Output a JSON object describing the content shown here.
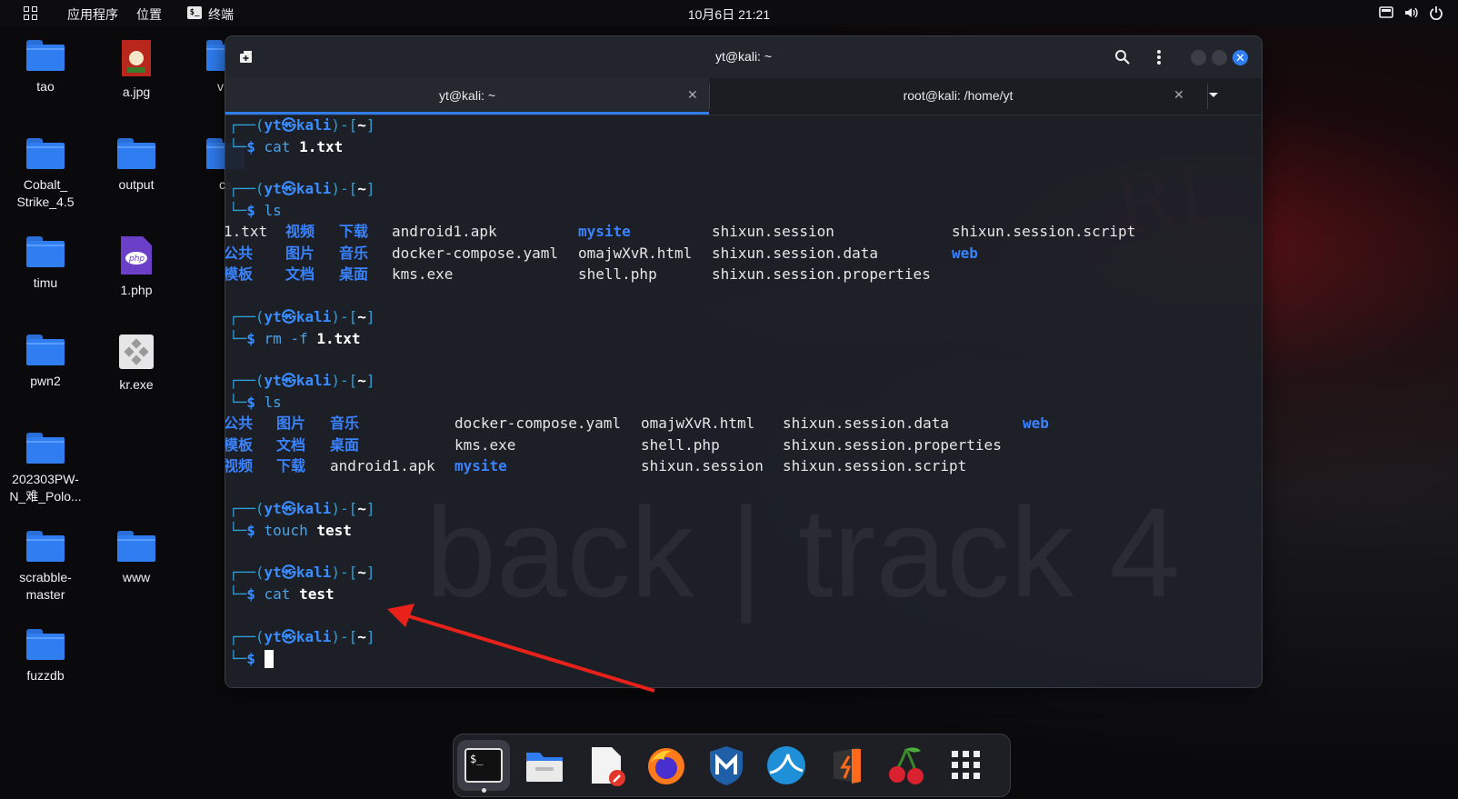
{
  "topbar": {
    "menu_apps": "应用程序",
    "menu_places": "位置",
    "menu_terminal": "终端",
    "clock": "10月6日  21:21"
  },
  "desktop_icons": [
    {
      "label": "tao",
      "type": "folder"
    },
    {
      "label": "a.jpg",
      "type": "image"
    },
    {
      "label": "vul",
      "type": "folder"
    },
    {
      "label": "Cobalt_\nStrike_4.5",
      "type": "folder"
    },
    {
      "label": "output",
      "type": "folder"
    },
    {
      "label": "cs",
      "type": "folder"
    },
    {
      "label": "timu",
      "type": "folder"
    },
    {
      "label": "1.php",
      "type": "php"
    },
    {
      "label": "pwn2",
      "type": "folder"
    },
    {
      "label": "kr.exe",
      "type": "exe"
    },
    {
      "label": "202303PW-\nN_难_Polo...",
      "type": "folder"
    },
    {
      "label": "scrabble-\nmaster",
      "type": "folder"
    },
    {
      "label": "www",
      "type": "folder"
    },
    {
      "label": "fuzzdb",
      "type": "folder"
    }
  ],
  "terminal": {
    "title": "yt@kali: ~",
    "tabs": [
      {
        "label": "yt@kali: ~",
        "active": true
      },
      {
        "label": "root@kali: /home/yt",
        "active": false
      }
    ],
    "watermark": "back | track 4",
    "prompt_user": "yt",
    "prompt_host": "kali",
    "prompt_dir": "~",
    "blocks": [
      {
        "cmd": "cat",
        "arg": "1.txt"
      },
      {
        "cmd": "ls",
        "arg": ""
      },
      {
        "cmd": "rm",
        "flag": "-f",
        "arg": "1.txt"
      },
      {
        "cmd": "ls",
        "arg": ""
      },
      {
        "cmd": "touch",
        "arg": "test"
      },
      {
        "cmd": "cat",
        "arg": "test"
      }
    ],
    "ls1": [
      [
        "1.txt",
        "视频",
        "下载",
        "android1.apk",
        "mysite",
        "shixun.session",
        "shixun.session.script"
      ],
      [
        "公共",
        "图片",
        "音乐",
        "docker-compose.yaml",
        "omajwXvR.html",
        "shixun.session.data",
        "web"
      ],
      [
        "模板",
        "文档",
        "桌面",
        "kms.exe",
        "shell.php",
        "shixun.session.properties",
        ""
      ]
    ],
    "ls2": [
      [
        "公共",
        "图片",
        "音乐",
        "docker-compose.yaml",
        "omajwXvR.html",
        "shixun.session.data",
        "web"
      ],
      [
        "模板",
        "文档",
        "桌面",
        "kms.exe",
        "shell.php",
        "shixun.session.properties",
        ""
      ],
      [
        "视频",
        "下载",
        "android1.apk",
        "mysite",
        "shixun.session",
        "shixun.session.script",
        ""
      ]
    ]
  },
  "dock": [
    {
      "name": "terminal"
    },
    {
      "name": "files"
    },
    {
      "name": "text-editor"
    },
    {
      "name": "firefox"
    },
    {
      "name": "metasploit"
    },
    {
      "name": "wireshark"
    },
    {
      "name": "burpsuite"
    },
    {
      "name": "cherrytree"
    },
    {
      "name": "show-apps"
    }
  ],
  "colors": {
    "accent": "#2f7df0",
    "prompt_frame": "#2f9fd6",
    "directory": "#3a83ff",
    "annotation_arrow": "#e8221b"
  }
}
